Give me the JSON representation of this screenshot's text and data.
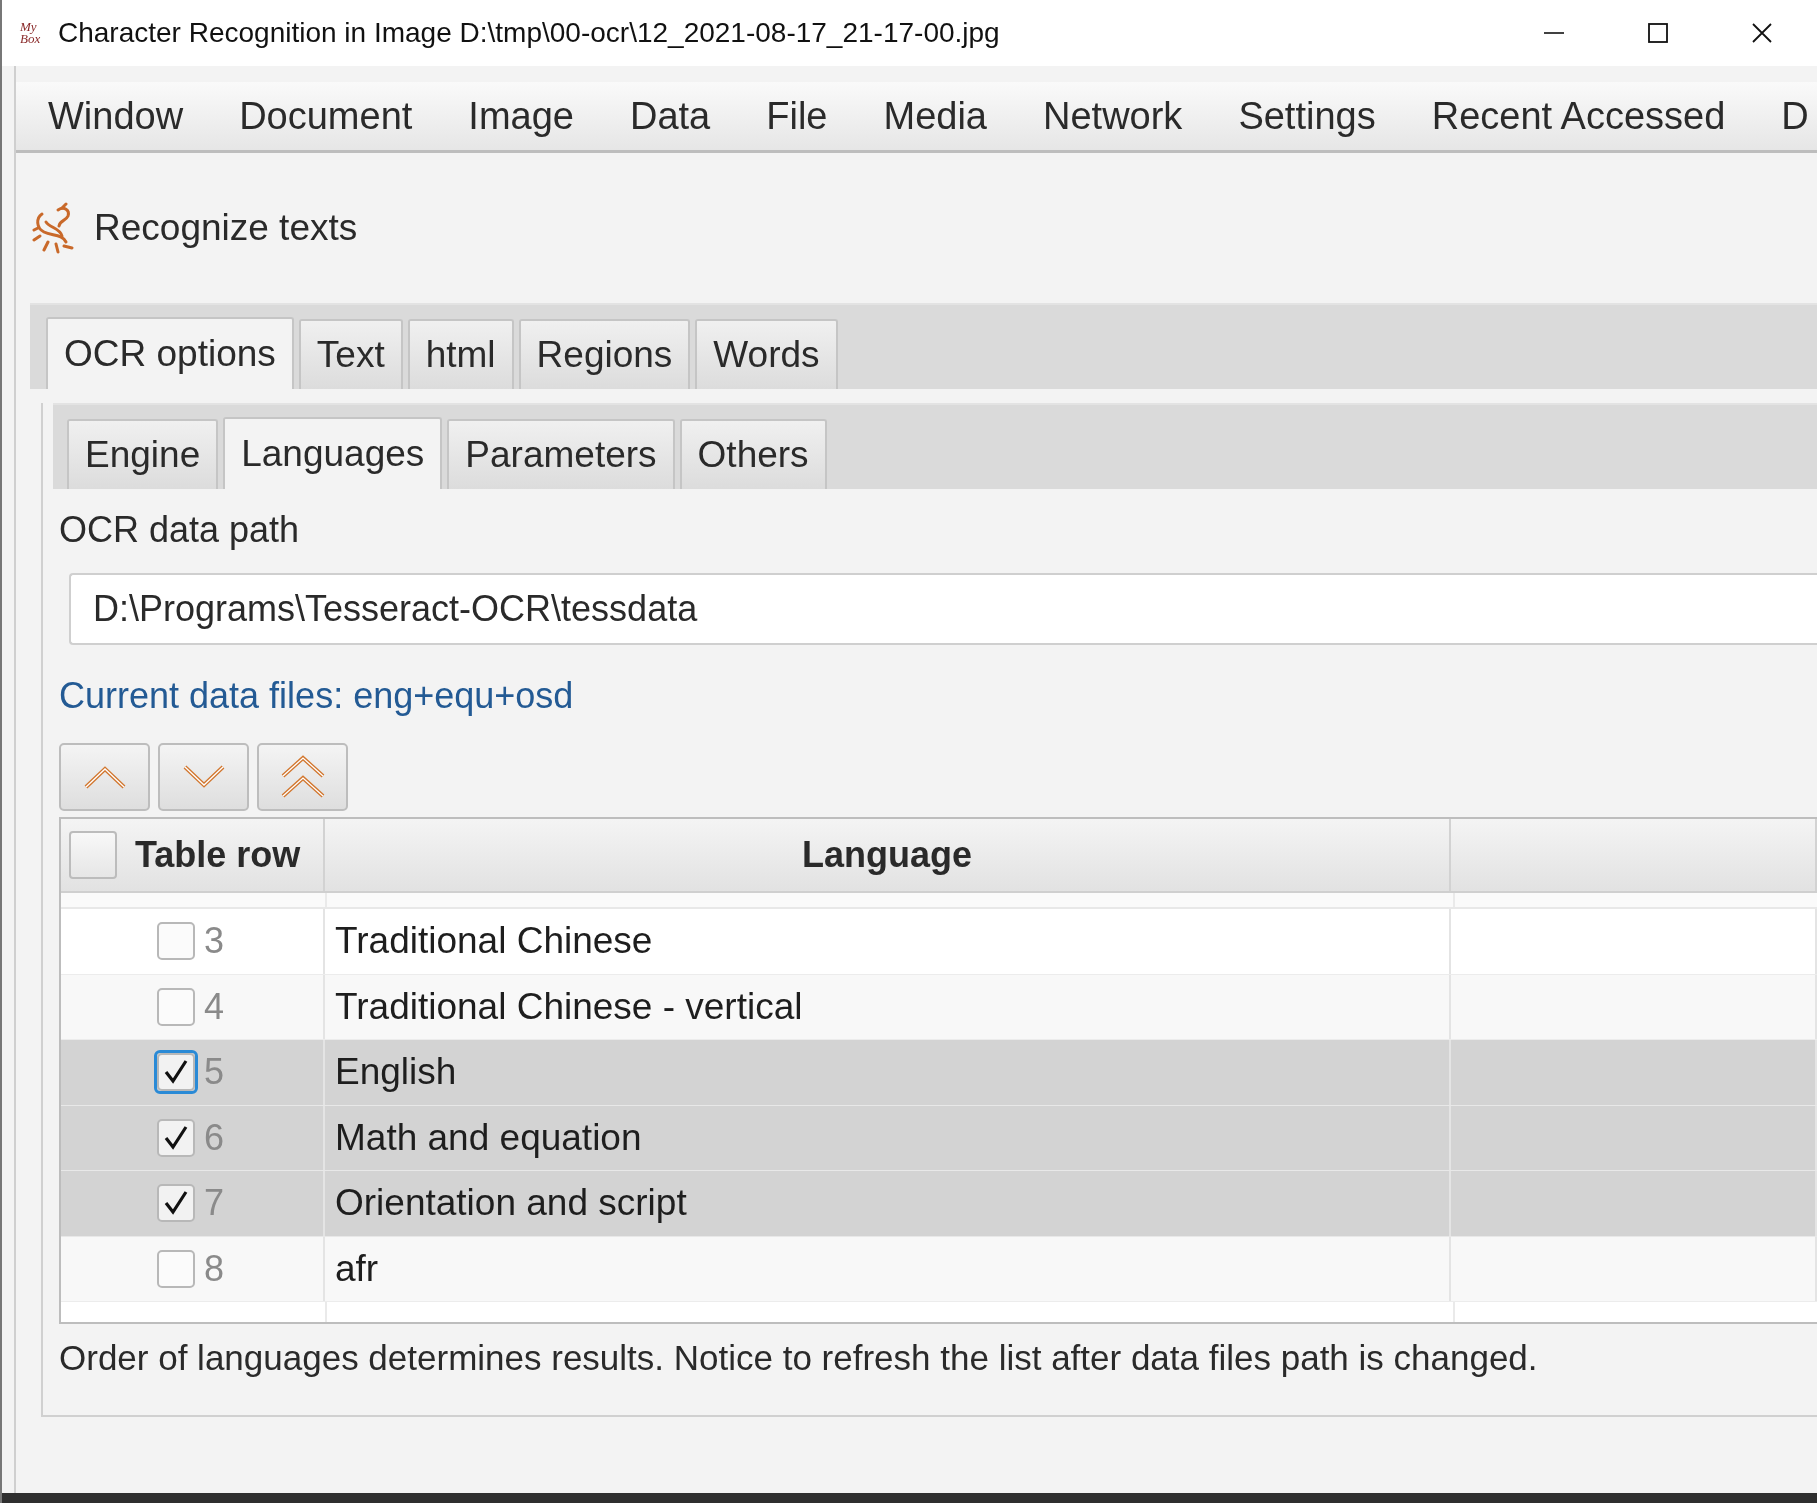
{
  "window": {
    "logo": "My Box",
    "title": "Character Recognition in Image D:\\tmp\\00-ocr\\12_2021-08-17_21-17-00.jpg"
  },
  "menu": [
    "Window",
    "Document",
    "Image",
    "Data",
    "File",
    "Media",
    "Network",
    "Settings",
    "Recent Accessed",
    "D"
  ],
  "header": {
    "title": "Recognize texts"
  },
  "tabs": [
    {
      "label": "OCR options",
      "selected": true
    },
    {
      "label": "Text",
      "selected": false
    },
    {
      "label": "html",
      "selected": false
    },
    {
      "label": "Regions",
      "selected": false
    },
    {
      "label": "Words",
      "selected": false
    }
  ],
  "subtabs": [
    {
      "label": "Engine",
      "selected": false
    },
    {
      "label": "Languages",
      "selected": true
    },
    {
      "label": "Parameters",
      "selected": false
    },
    {
      "label": "Others",
      "selected": false
    }
  ],
  "data_path": {
    "label": "OCR data path",
    "value": "D:\\Programs\\Tesseract-OCR\\tessdata"
  },
  "current_files": "Current data files: eng+equ+osd",
  "table": {
    "select_all_checked": false,
    "columns": [
      "Table row",
      "Language"
    ],
    "rows": [
      {
        "number": "3",
        "language": "Traditional Chinese",
        "checked": false,
        "selected": false,
        "focused": false
      },
      {
        "number": "4",
        "language": "Traditional Chinese - vertical",
        "checked": false,
        "selected": false,
        "focused": false
      },
      {
        "number": "5",
        "language": "English",
        "checked": true,
        "selected": true,
        "focused": true
      },
      {
        "number": "6",
        "language": "Math and equation",
        "checked": true,
        "selected": true,
        "focused": false
      },
      {
        "number": "7",
        "language": "Orientation and script",
        "checked": true,
        "selected": true,
        "focused": false
      },
      {
        "number": "8",
        "language": "afr",
        "checked": false,
        "selected": false,
        "focused": false
      }
    ]
  },
  "note": "Order of languages determines results. Notice to refresh the list after data files path is changed."
}
